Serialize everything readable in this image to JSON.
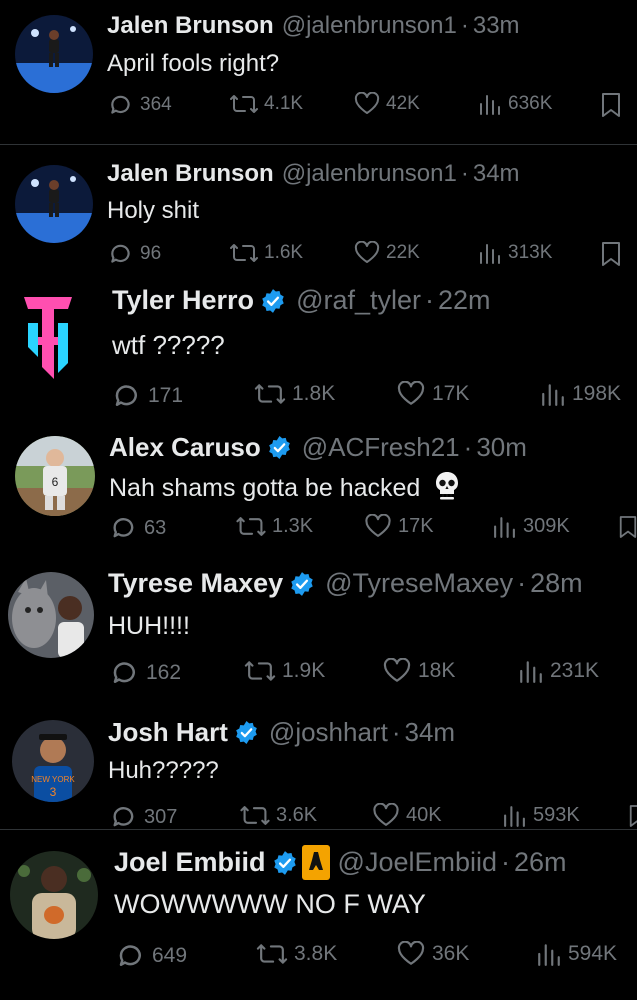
{
  "tweets": [
    {
      "name": "Jalen Brunson",
      "handle": "@jalenbrunson1",
      "dot": "·",
      "time": "33m",
      "text": "April fools right?",
      "verified": false,
      "replies": "364",
      "retweets": "4.1K",
      "likes": "42K",
      "views": "636K",
      "avatar": "court-photo"
    },
    {
      "name": "Jalen Brunson",
      "handle": "@jalenbrunson1",
      "dot": "·",
      "time": "34m",
      "text": "Holy shit",
      "verified": false,
      "replies": "96",
      "retweets": "1.6K",
      "likes": "22K",
      "views": "313K",
      "avatar": "court-photo"
    },
    {
      "name": "Tyler Herro",
      "handle": "@raf_tyler",
      "dot": "·",
      "time": "22m",
      "text": "wtf ?????",
      "verified": true,
      "replies": "171",
      "retweets": "1.8K",
      "likes": "17K",
      "views": "198K",
      "avatar": "th-logo"
    },
    {
      "name": "Alex Caruso",
      "handle": "@ACFresh21",
      "dot": "·",
      "time": "30m",
      "text": "Nah shams gotta be hacked",
      "verified": true,
      "replies": "63",
      "retweets": "1.3K",
      "likes": "17K",
      "views": "309K",
      "avatar": "jersey-6-photo",
      "emoji": "skull-icon"
    },
    {
      "name": "Tyrese Maxey",
      "handle": "@TyreseMaxey",
      "dot": "·",
      "time": "28m",
      "text": "HUH!!!!",
      "verified": true,
      "replies": "162",
      "retweets": "1.9K",
      "likes": "18K",
      "views": "231K",
      "avatar": "cat-photo"
    },
    {
      "name": "Josh Hart",
      "handle": "@joshhart",
      "dot": "·",
      "time": "34m",
      "text": "Huh?????",
      "verified": true,
      "replies": "307",
      "retweets": "3.6K",
      "likes": "40K",
      "views": "593K",
      "avatar": "knicks-photo"
    },
    {
      "name": "Joel Embiid",
      "handle": "@JoelEmbiid",
      "dot": "·",
      "time": "26m",
      "text": "WOWWWWW NO F WAY",
      "verified": true,
      "flag": "eiffel-tower-icon",
      "replies": "649",
      "retweets": "3.8K",
      "likes": "36K",
      "views": "594K",
      "avatar": "embiid-photo"
    }
  ],
  "colors": {
    "background": "#000000",
    "text": "#e7e9ea",
    "muted": "#71767b",
    "verified": "#1d9bf0",
    "divider": "#2f3336"
  }
}
